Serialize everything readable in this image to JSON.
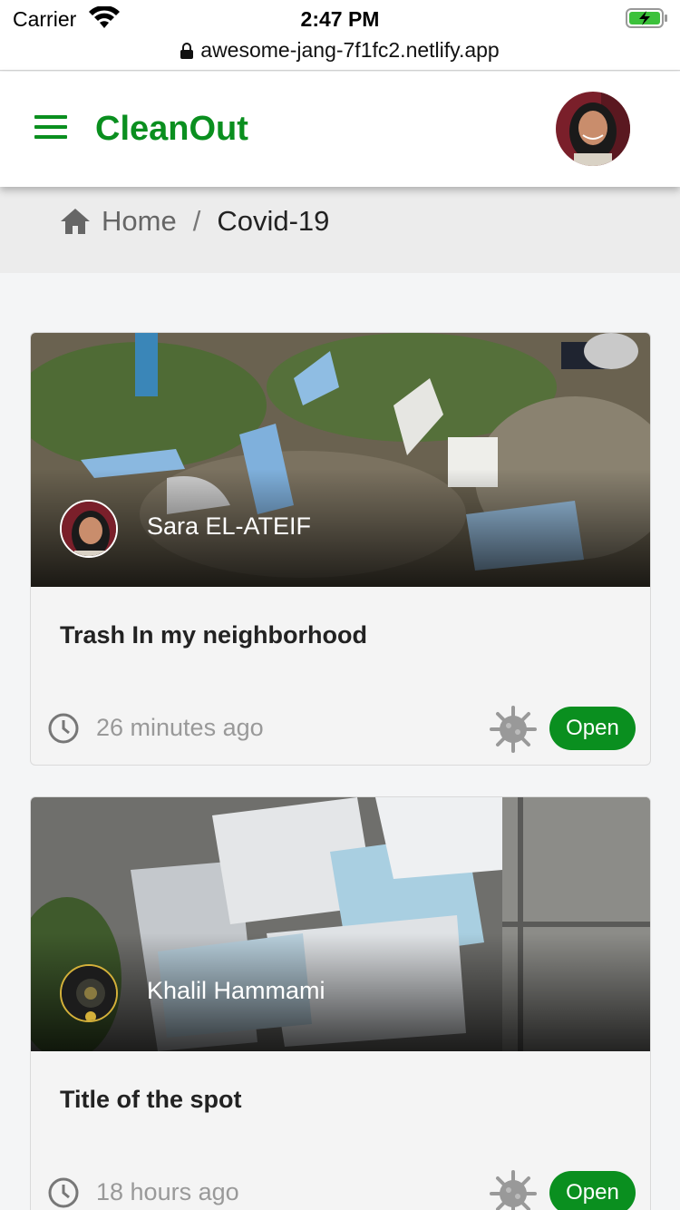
{
  "status_bar": {
    "carrier": "Carrier",
    "time": "2:47 PM",
    "wifi_icon": "wifi-icon",
    "battery_icon": "battery-charging-icon"
  },
  "browser": {
    "url": "awesome-jang-7f1fc2.netlify.app",
    "lock_icon": "lock-icon"
  },
  "header": {
    "menu_icon": "hamburger-menu-icon",
    "title": "CleanOut",
    "accent_color": "#0a8f1f",
    "avatar": "user-avatar"
  },
  "breadcrumb": {
    "home_icon": "home-icon",
    "home_label": "Home",
    "separator": "/",
    "current": "Covid-19"
  },
  "cards": [
    {
      "author": "Sara EL-ATEIF",
      "title": "Trash In my neighborhood",
      "time_ago": "26 minutes ago",
      "category_icon": "virus-icon",
      "status": "Open"
    },
    {
      "author": "Khalil Hammami",
      "title": "Title of the spot",
      "time_ago": "18 hours ago",
      "category_icon": "virus-icon",
      "status": "Open"
    }
  ]
}
